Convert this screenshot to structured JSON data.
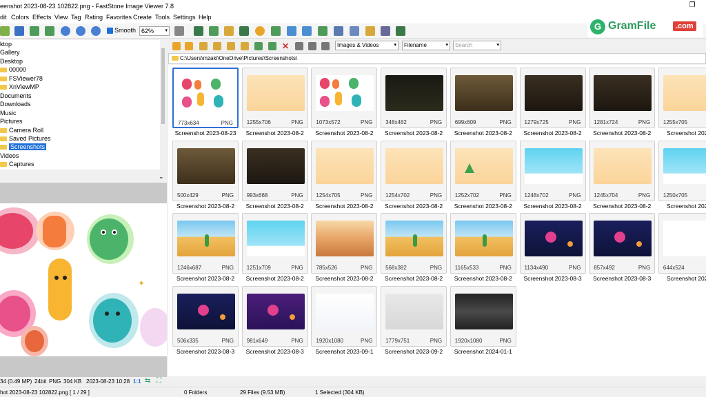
{
  "window": {
    "title": "eenshot 2023-08-23 102822.png  -  FastStone Image Viewer 7.8",
    "max_glyph": "❐"
  },
  "menu": [
    "dit",
    "Colors",
    "Effects",
    "View",
    "Tag",
    "Rating",
    "Favorites",
    "Create",
    "Tools",
    "Settings",
    "Help"
  ],
  "toolbar": {
    "smooth_label": "Smooth",
    "zoom": "62%"
  },
  "watermark": {
    "icon_letter": "G",
    "name": "GramFile",
    "suffix": ".com"
  },
  "tree": {
    "items": [
      "ktop",
      "Gallery",
      "Desktop",
      "00000",
      "FSViewer78",
      "XnViewMP",
      "Documents",
      "Downloads",
      "Music",
      "Pictures",
      "Camera Roll",
      "Saved Pictures",
      "Screenshots",
      "Videos",
      "Captures"
    ],
    "selected": "Screenshots"
  },
  "browser": {
    "filter": "Images & Videos",
    "sort": "Filename",
    "search_placeholder": "Search",
    "path": "C:\\Users\\mzaki\\OneDrive\\Pictures\\Screenshots\\"
  },
  "thumbnails": [
    {
      "dims": "773x634",
      "fmt": "PNG",
      "name": "Screenshot 2023-08-23",
      "thumb": "letters",
      "selected": true
    },
    {
      "dims": "1255x706",
      "fmt": "PNG",
      "name": "Screenshot 2023-08-2",
      "thumb": "peach"
    },
    {
      "dims": "1073x572",
      "fmt": "PNG",
      "name": "Screenshot 2023-08-2",
      "thumb": "letters"
    },
    {
      "dims": "348x482",
      "fmt": "PNG",
      "name": "Screenshot 2023-08-2",
      "thumb": "dark"
    },
    {
      "dims": "699x609",
      "fmt": "PNG",
      "name": "Screenshot 2023-08-2",
      "thumb": "sepia"
    },
    {
      "dims": "1279x725",
      "fmt": "PNG",
      "name": "Screenshot 2023-08-2",
      "thumb": "sepiadark"
    },
    {
      "dims": "1281x724",
      "fmt": "PNG",
      "name": "Screenshot 2023-08-2",
      "thumb": "sepiadark"
    },
    {
      "dims": "1255x705",
      "fmt": "PNG",
      "name": "Screenshot 2023-0",
      "thumb": "peach"
    },
    {
      "dims": "500x429",
      "fmt": "PNG",
      "name": "Screenshot 2023-08-2",
      "thumb": "sepia"
    },
    {
      "dims": "993x668",
      "fmt": "PNG",
      "name": "Screenshot 2023-08-2",
      "thumb": "sepiadark"
    },
    {
      "dims": "1254x705",
      "fmt": "PNG",
      "name": "Screenshot 2023-08-2",
      "thumb": "peach"
    },
    {
      "dims": "1254x702",
      "fmt": "PNG",
      "name": "Screenshot 2023-08-2",
      "thumb": "peach"
    },
    {
      "dims": "1252x702",
      "fmt": "PNG",
      "name": "Screenshot 2023-08-2",
      "thumb": "peachtree"
    },
    {
      "dims": "1248x702",
      "fmt": "PNG",
      "name": "Screenshot 2023-08-2",
      "thumb": "sky"
    },
    {
      "dims": "1245x704",
      "fmt": "PNG",
      "name": "Screenshot 2023-08-2",
      "thumb": "peach"
    },
    {
      "dims": "1250x705",
      "fmt": "PNG",
      "name": "Screenshot 2023-0",
      "thumb": "sky"
    },
    {
      "dims": "1246x687",
      "fmt": "PNG",
      "name": "Screenshot 2023-08-2",
      "thumb": "desert"
    },
    {
      "dims": "1251x709",
      "fmt": "PNG",
      "name": "Screenshot 2023-08-2",
      "thumb": "sky"
    },
    {
      "dims": "785x526",
      "fmt": "PNG",
      "name": "Screenshot 2023-08-2",
      "thumb": "canyon"
    },
    {
      "dims": "568x382",
      "fmt": "PNG",
      "name": "Screenshot 2023-08-2",
      "thumb": "desert"
    },
    {
      "dims": "1165x533",
      "fmt": "PNG",
      "name": "Screenshot 2023-08-2",
      "thumb": "desert"
    },
    {
      "dims": "1134x490",
      "fmt": "PNG",
      "name": "Screenshot 2023-08-3",
      "thumb": "space"
    },
    {
      "dims": "857x492",
      "fmt": "PNG",
      "name": "Screenshot 2023-08-3",
      "thumb": "space"
    },
    {
      "dims": "644x524",
      "fmt": "PNG",
      "name": "Screenshot 2023-0",
      "thumb": "icons"
    },
    {
      "dims": "506x335",
      "fmt": "PNG",
      "name": "Screenshot 2023-08-3",
      "thumb": "space"
    },
    {
      "dims": "981x649",
      "fmt": "PNG",
      "name": "Screenshot 2023-08-3",
      "thumb": "spacepink"
    },
    {
      "dims": "1920x1080",
      "fmt": "PNG",
      "name": "Screenshot 2023-09-1",
      "thumb": "doc"
    },
    {
      "dims": "1779x751",
      "fmt": "PNG",
      "name": "Screenshot 2023-09-2",
      "thumb": "gallery"
    },
    {
      "dims": "1920x1080",
      "fmt": "PNG",
      "name": "Screenshot 2024-01-1",
      "thumb": "gray"
    }
  ],
  "image_info": {
    "res": "34 (0.49 MP)",
    "bits": "24bit",
    "fmt": "PNG",
    "size": "304 KB",
    "date": "2023-08-23 10:28",
    "ratio": "1:1"
  },
  "status": {
    "file": "hot 2023-08-23 102822.png [ 1 / 29 ]",
    "folders": "0 Folders",
    "files": "29 Files (9.53 MB)",
    "selected": "1 Selected (304 KB)"
  },
  "colors": {
    "accent": "#2f6fd6",
    "folder": "#f2c84b",
    "brand_green": "#2b9a5c",
    "brand_red": "#e0403a"
  }
}
